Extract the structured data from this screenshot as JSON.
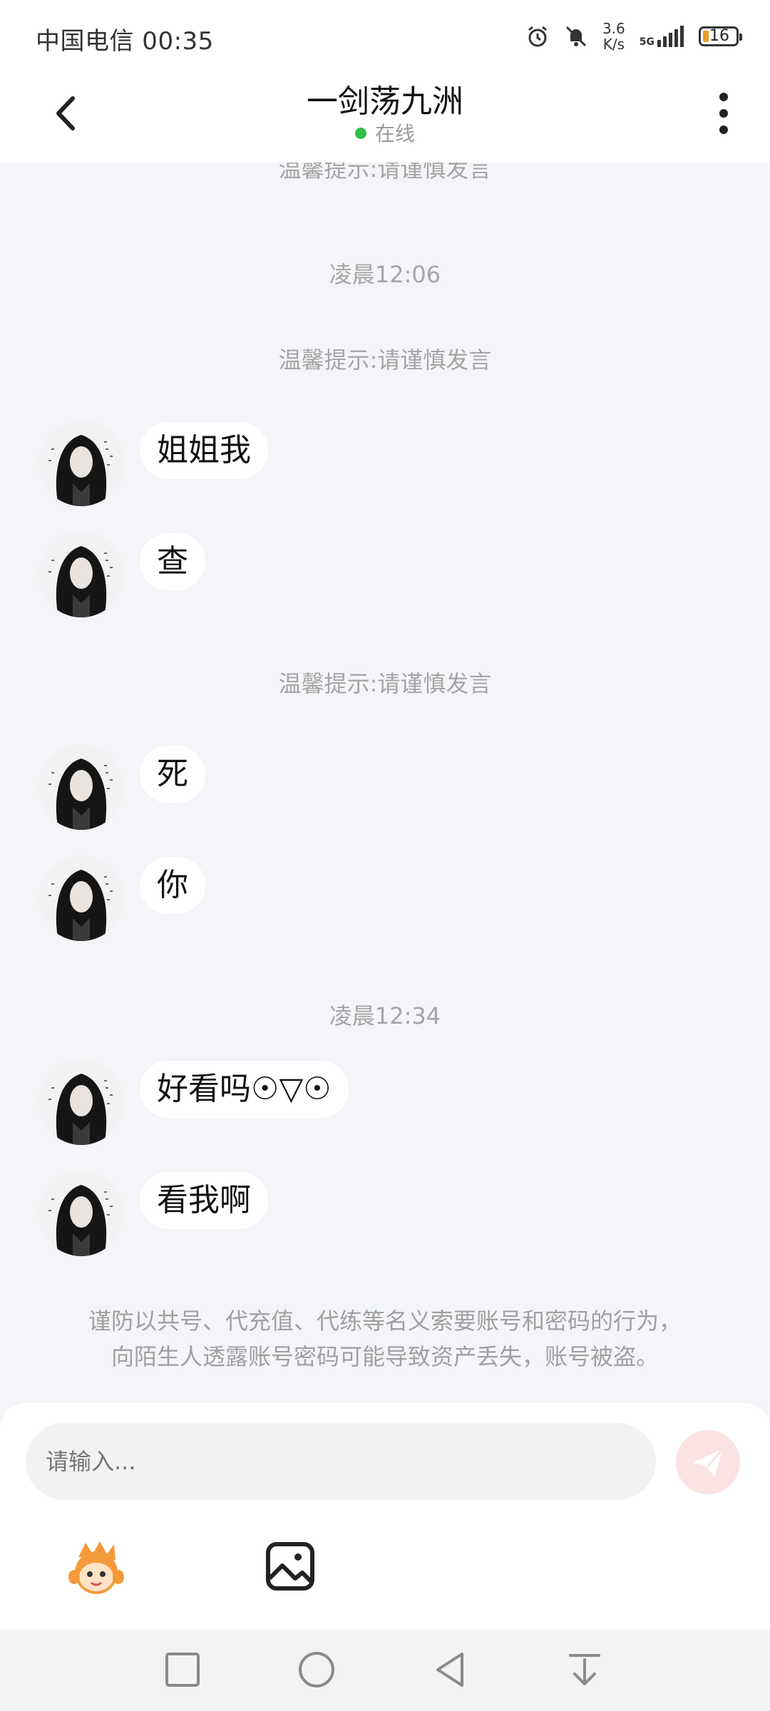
{
  "status_bar": {
    "carrier_time": "中国电信 00:35",
    "speed_value": "3.6",
    "speed_unit": "K/s",
    "network": "5G",
    "battery": "16"
  },
  "header": {
    "title": "一剑荡九洲",
    "status": "在线"
  },
  "chat": {
    "partial_tip": "温馨提示:请谨慎发言",
    "items": [
      {
        "type": "time",
        "text": "凌晨12:06"
      },
      {
        "type": "tip",
        "text": "温馨提示:请谨慎发言"
      },
      {
        "type": "msg",
        "text": "姐姐我"
      },
      {
        "type": "msg",
        "text": "查"
      },
      {
        "type": "tip",
        "text": "温馨提示:请谨慎发言"
      },
      {
        "type": "msg",
        "text": "死"
      },
      {
        "type": "msg",
        "text": "你"
      },
      {
        "type": "time",
        "text": "凌晨12:34"
      },
      {
        "type": "msg",
        "text": "好看吗☉▽☉"
      },
      {
        "type": "msg",
        "text": "看我啊"
      }
    ],
    "notice_line1": "谨防以共号、代充值、代练等名义索要账号和密码的行为，",
    "notice_line2": "向陌生人透露账号密码可能导致资产丢失，账号被盗。"
  },
  "input": {
    "placeholder": "请输入..."
  },
  "icons": {
    "back": "chevron-left-icon",
    "more": "more-vertical-icon",
    "send": "paper-plane-icon",
    "emoji": "emoji-mascot-icon",
    "image": "image-icon",
    "nav_recent": "square-icon",
    "nav_home": "circle-icon",
    "nav_back": "triangle-back-icon",
    "nav_down": "arrow-down-icon"
  },
  "colors": {
    "online_dot": "#2fbf4a",
    "send_button": "#fbe3e3",
    "emoji_orange": "#f59a3b"
  }
}
